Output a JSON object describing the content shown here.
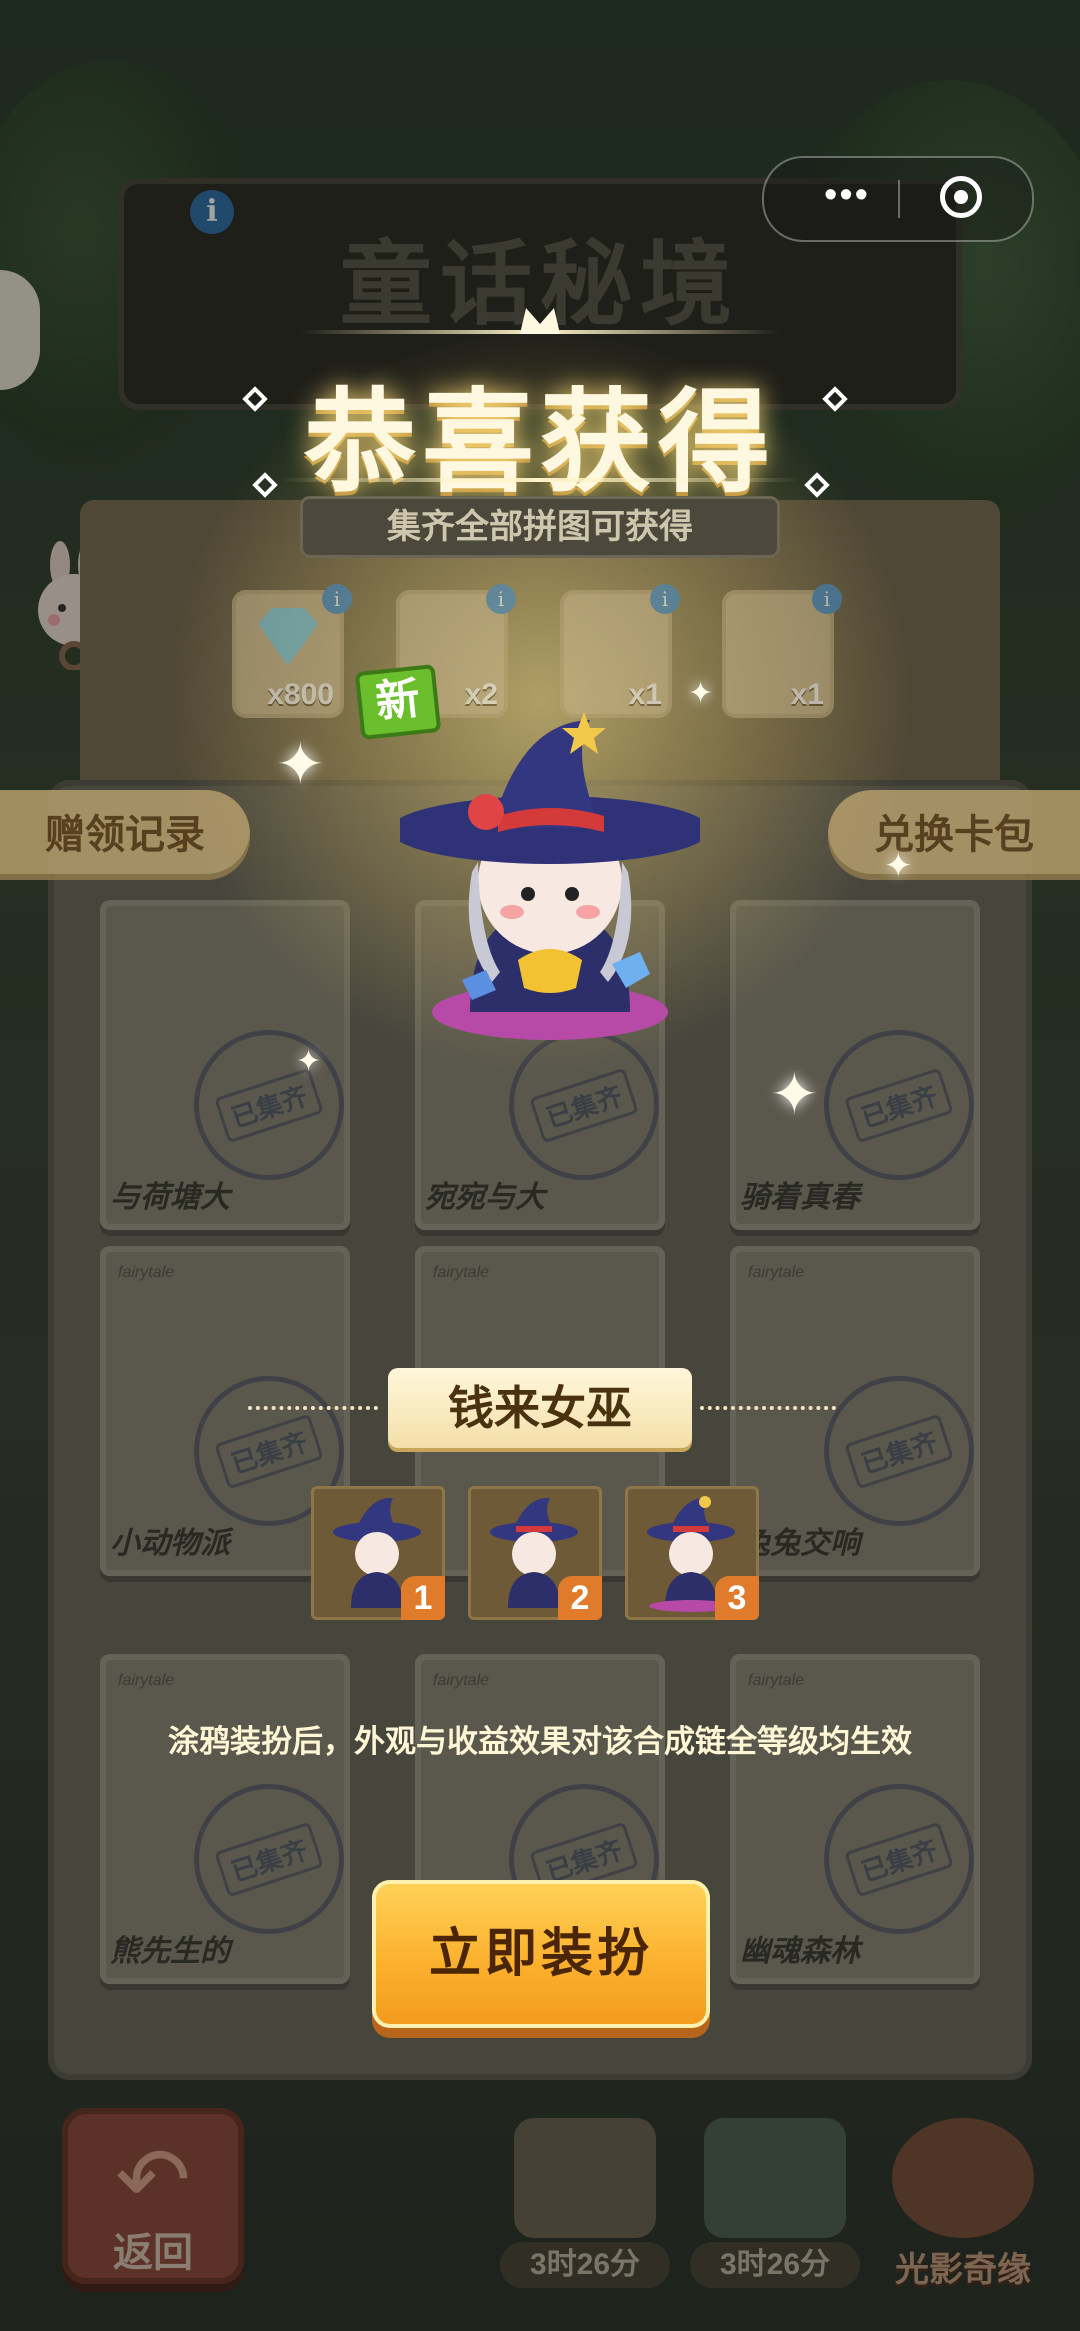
{
  "header": {
    "sign_title": "童话秘境",
    "info_icon": "i",
    "capsule": {
      "more_icon": "•••",
      "close_icon": "target-icon"
    }
  },
  "popup": {
    "congrats": "恭喜获得",
    "sub_banner": "集齐全部拼图可获得",
    "new_badge": "新",
    "item_name": "钱来女巫",
    "levels": [
      "1",
      "2",
      "3"
    ],
    "note": "涂鸦装扮后，外观与收益效果对该合成链全等级均生效",
    "equip_button": "立即装扮"
  },
  "rewards": [
    {
      "icon": "diamond-icon",
      "count": "x800"
    },
    {
      "icon": "character-icon",
      "count": "x2"
    },
    {
      "icon": "frame-icon",
      "count": "x1"
    },
    {
      "icon": "witch-icon",
      "count": "x1"
    }
  ],
  "side_tabs": {
    "left": "赠领记录",
    "right": "兑换卡包"
  },
  "cards": [
    {
      "title": "与荷塘大",
      "stamp": "已集齐"
    },
    {
      "title": "宛宛与大",
      "stamp": "已集齐"
    },
    {
      "title": "骑着真春",
      "stamp": "已集齐"
    },
    {
      "title": "小动物派",
      "stamp": "已集齐"
    },
    {
      "title": "",
      "stamp": ""
    },
    {
      "title": "兔兔交响",
      "stamp": "已集齐"
    },
    {
      "title": "熊先生的",
      "stamp": "已集齐"
    },
    {
      "title": "",
      "stamp": "已集齐"
    },
    {
      "title": "幽魂森林",
      "stamp": "已集齐"
    }
  ],
  "card_tag": "fairytale",
  "bottom": {
    "back_label": "返回",
    "timer1": "3时26分",
    "timer2": "3时26分",
    "light": "光影奇缘"
  },
  "colors": {
    "accent": "#fbb12e",
    "new_badge": "#6bbf2c",
    "level_badge": "#e07b2c"
  }
}
